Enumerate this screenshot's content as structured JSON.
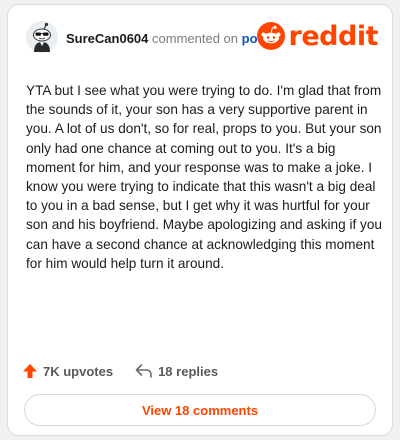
{
  "header": {
    "username": "SureCan0604",
    "action_text": "commented on",
    "link_text": "post",
    "logo_text": "reddit"
  },
  "comment": {
    "text": "YTA but I see what you were trying to do. I'm glad that from the sounds of it, your son has a very supportive parent in you. A lot of us don't, so for real, props to you. But your son only had one chance at coming out to you. It's a big moment for him, and your response was to make a joke. I know you were trying to indicate that this wasn't a big deal to you in a bad sense, but I get why it was hurtful for your son and his boyfriend. Maybe apologizing and asking if you can have a second chance at acknowledging this moment for him would help turn it around."
  },
  "actions": {
    "upvotes": "7K upvotes",
    "replies": "18 replies",
    "upvote_icon": "upvote-arrow-icon",
    "reply_icon": "reply-arrow-icon"
  },
  "view_button": {
    "label": "View 18 comments"
  },
  "colors": {
    "brand": "#ff4500",
    "link": "#0b53c6",
    "text": "#1c1c1c",
    "muted": "#5a5a5a"
  }
}
